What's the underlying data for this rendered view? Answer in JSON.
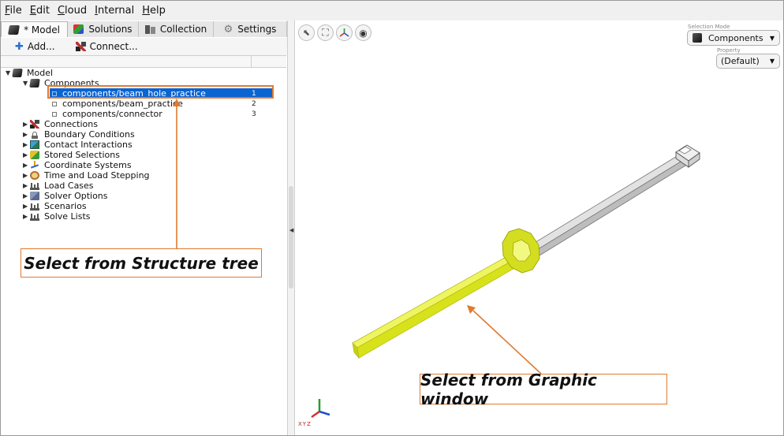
{
  "menu": [
    {
      "label": "File",
      "mnemonic": "F",
      "rest": "ile"
    },
    {
      "label": "Edit",
      "mnemonic": "E",
      "rest": "dit"
    },
    {
      "label": "Cloud",
      "mnemonic": "C",
      "rest": "loud"
    },
    {
      "label": "Internal",
      "mnemonic": "I",
      "rest": "nternal"
    },
    {
      "label": "Help",
      "mnemonic": "H",
      "rest": "elp"
    }
  ],
  "tabs": {
    "model": "* Model",
    "solutions": "Solutions",
    "collection": "Collection",
    "settings": "Settings"
  },
  "toolbar": {
    "add": "Add...",
    "connect": "Connect..."
  },
  "tree": {
    "root": "Model",
    "components": "Components",
    "component_items": [
      {
        "name": "components/beam_hole_practice",
        "id": "1"
      },
      {
        "name": "components/beam_practice",
        "id": "2"
      },
      {
        "name": "components/connector",
        "id": "3"
      }
    ],
    "folders": [
      "Connections",
      "Boundary Conditions",
      "Contact Interactions",
      "Stored Selections",
      "Coordinate Systems",
      "Time and Load Stepping",
      "Load Cases",
      "Solver Options",
      "Scenarios",
      "Solve Lists"
    ]
  },
  "graphics": {
    "selection_mode_label": "Selection Mode",
    "selection_mode_value": "Components",
    "property_label": "Property",
    "property_value": "(Default)",
    "triad_label": "XYZ"
  },
  "callouts": {
    "tree": "Select from Structure tree",
    "graphic": "Select from Graphic window"
  },
  "colors": {
    "selection_blue": "#0a64d2",
    "highlight_yellow": "#e6f230",
    "callout_orange": "#e07a30",
    "beam_gray": "#c8c8c8"
  }
}
